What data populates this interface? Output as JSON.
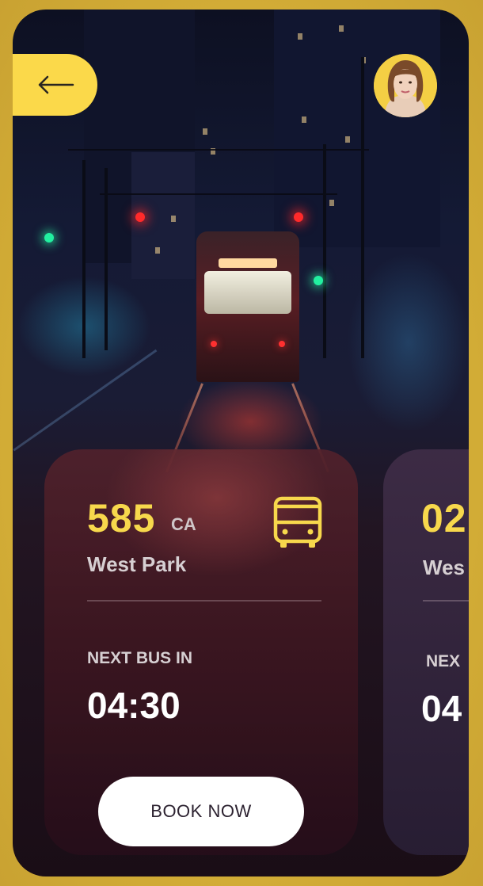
{
  "header": {
    "back_icon": "arrow-left-icon",
    "avatar_icon": "user-avatar"
  },
  "cards": [
    {
      "route_number": "585",
      "route_code": "CA",
      "stop_name": "West Park",
      "icon": "bus-icon",
      "next_label": "NEXT BUS IN",
      "next_time": "04:30",
      "book_label": "BOOK NOW"
    },
    {
      "route_number": "02",
      "stop_name": "Wes",
      "next_label": "NEX",
      "next_time": "04"
    }
  ],
  "colors": {
    "accent": "#fbd94a",
    "frame": "#d4b13a",
    "route_number": "#f7d84c",
    "card_bg": "#4a1c28",
    "button_bg": "#ffffff"
  }
}
